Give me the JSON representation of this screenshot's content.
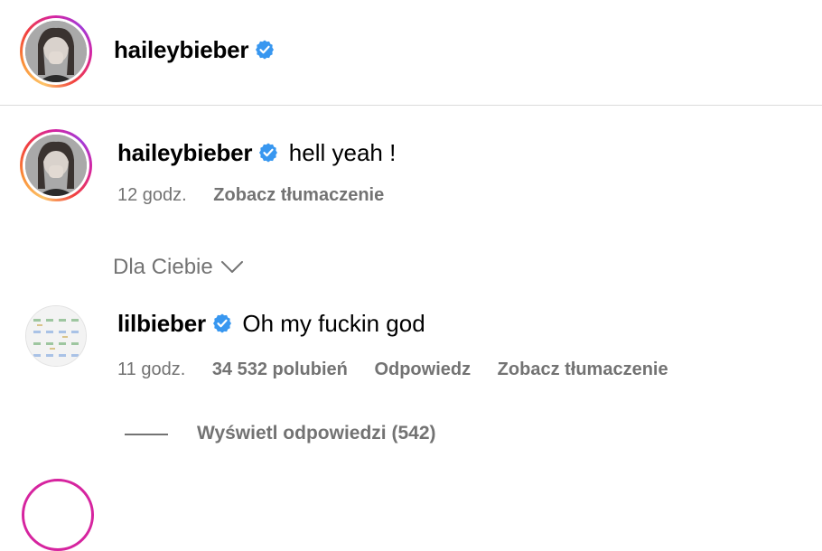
{
  "post_header": {
    "username": "haileybieber"
  },
  "comments": [
    {
      "username": "haileybieber",
      "text": "hell yeah !",
      "time": "12 godz.",
      "translate_label": "Zobacz tłumaczenie"
    },
    {
      "username": "lilbieber",
      "text": "Oh my fuckin god",
      "time": "11 godz.",
      "likes": "34 532 polubień",
      "reply_label": "Odpowiedz",
      "translate_label": "Zobacz tłumaczenie",
      "view_replies": "Wyświetl odpowiedzi (542)"
    }
  ],
  "sort_filter": {
    "label": "Dla Ciebie"
  },
  "colors": {
    "verified": "#3897f0",
    "muted_text": "#737373",
    "divider": "#dbdbdb"
  },
  "icons": [
    "verified-badge-icon",
    "chevron-down-icon"
  ]
}
